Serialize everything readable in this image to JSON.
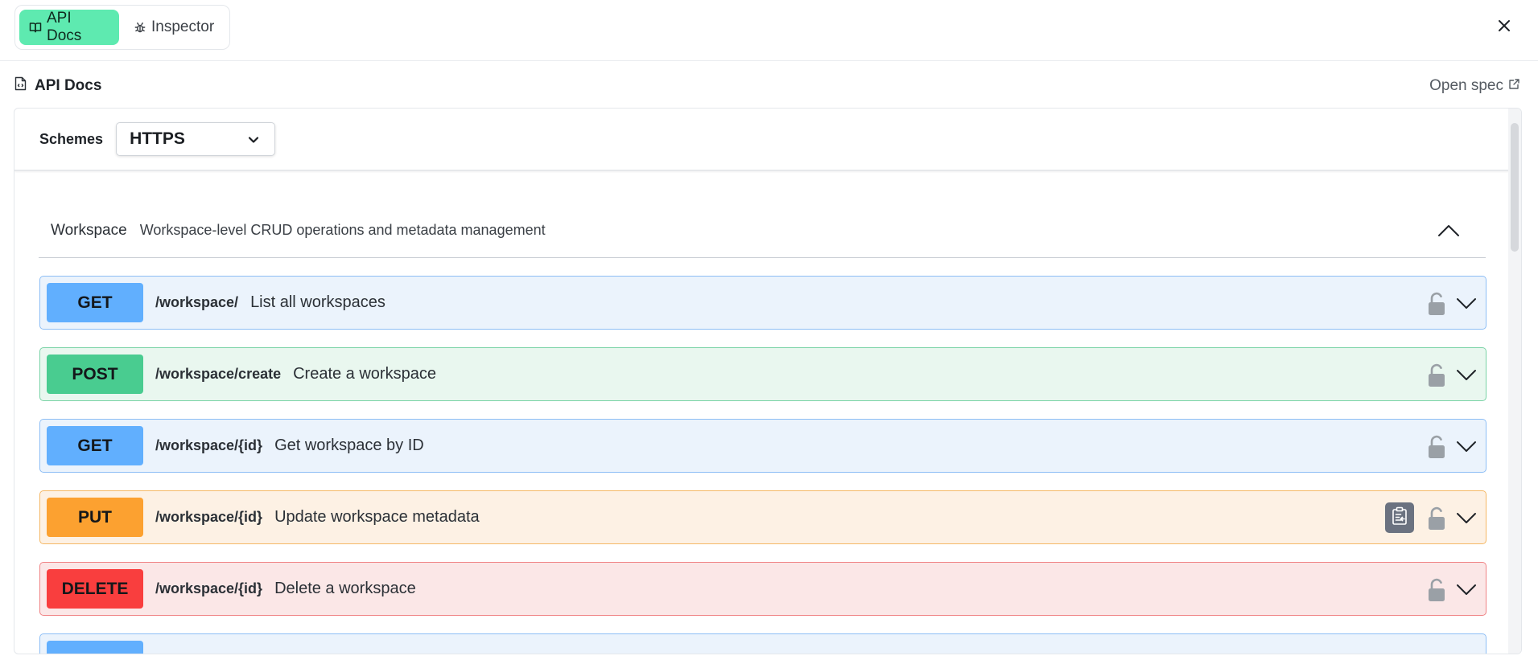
{
  "tabs": [
    {
      "label": "API Docs",
      "icon": "book-open-icon",
      "active": true
    },
    {
      "label": "Inspector",
      "icon": "bug-icon",
      "active": false
    }
  ],
  "header": {
    "title": "API Docs",
    "title_icon": "file-code-icon",
    "open_spec_label": "Open spec",
    "open_spec_icon": "external-link-icon"
  },
  "schemes": {
    "label": "Schemes",
    "selected": "HTTPS"
  },
  "tag": {
    "name": "Workspace",
    "description": "Workspace-level CRUD operations and metadata management"
  },
  "operations": [
    {
      "method": "GET",
      "path": "/workspace/",
      "summary": "List all workspaces"
    },
    {
      "method": "POST",
      "path": "/workspace/create",
      "summary": "Create a workspace"
    },
    {
      "method": "GET",
      "path": "/workspace/{id}",
      "summary": "Get workspace by ID"
    },
    {
      "method": "PUT",
      "path": "/workspace/{id}",
      "summary": "Update workspace metadata"
    },
    {
      "method": "DELETE",
      "path": "/workspace/{id}",
      "summary": "Delete a workspace"
    }
  ],
  "colors": {
    "accent_tab": "#5eeab0",
    "get": "#61affe",
    "post": "#49cc90",
    "put": "#fca130",
    "delete": "#f93e3e"
  }
}
